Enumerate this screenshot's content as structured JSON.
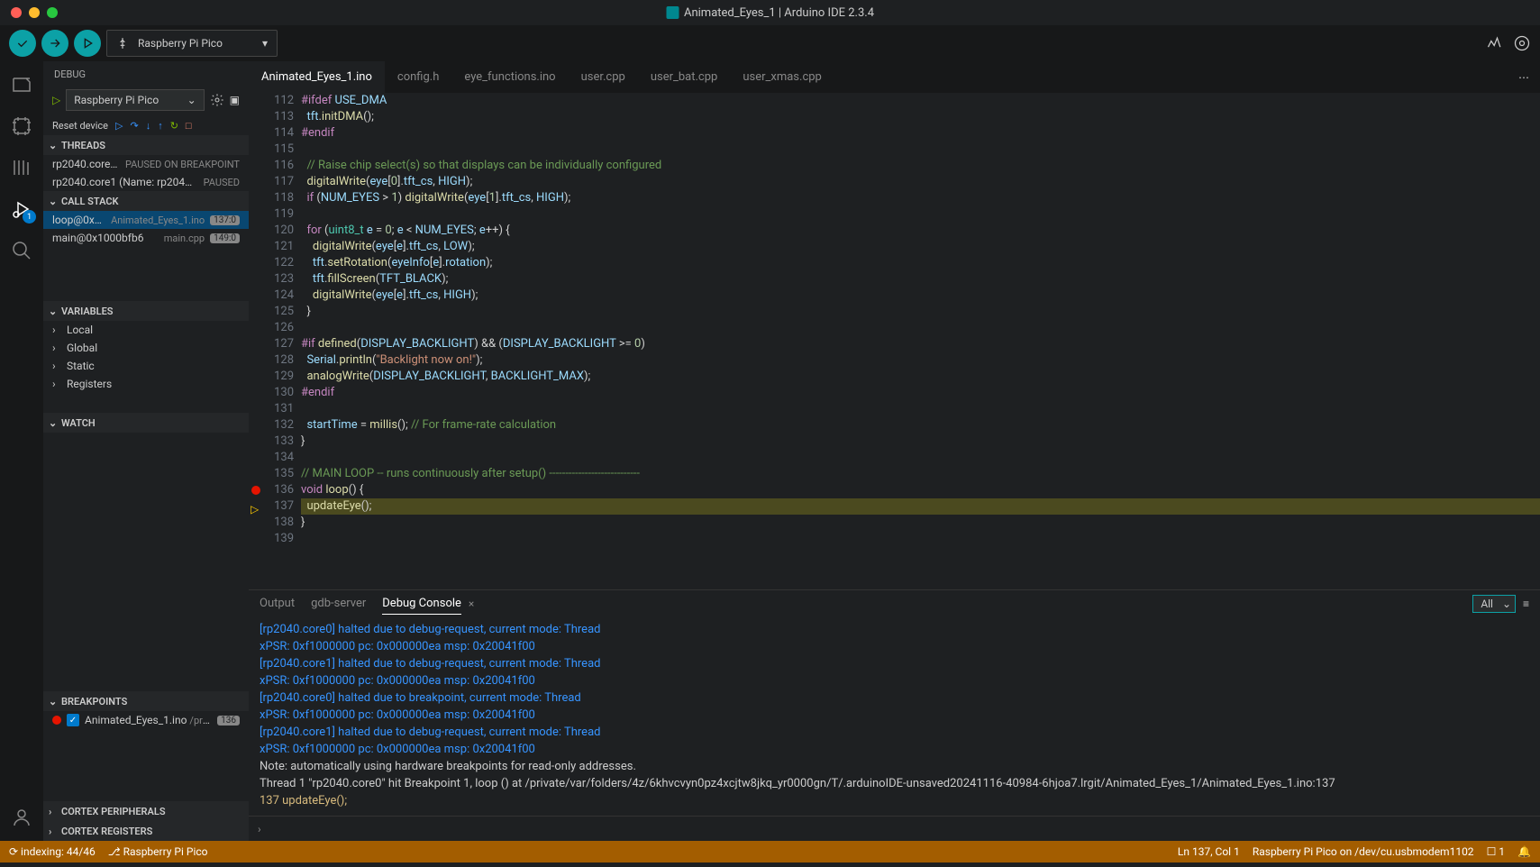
{
  "window": {
    "title": "Animated_Eyes_1 | Arduino IDE 2.3.4"
  },
  "toolbar": {
    "board": "Raspberry Pi Pico"
  },
  "debug": {
    "title": "DEBUG",
    "config": "Raspberry Pi Pico",
    "reset": "Reset device"
  },
  "sections": {
    "threads": "THREADS",
    "callstack": "CALL STACK",
    "variables": "VARIABLES",
    "watch": "WATCH",
    "breakpoints": "BREAKPOINTS",
    "cortex_periph": "CORTEX PERIPHERALS",
    "cortex_reg": "CORTEX REGISTERS"
  },
  "threads": [
    {
      "name": "rp2040.core0 (...",
      "state": "PAUSED ON BREAKPOINT"
    },
    {
      "name": "rp2040.core1 (Name: rp2040.core...",
      "state": "PAUSED"
    }
  ],
  "callstack": [
    {
      "fn": "loop@0x10003...",
      "file": "Animated_Eyes_1.ino",
      "line": "137:0"
    },
    {
      "fn": "main@0x1000bfb6",
      "file": "main.cpp",
      "line": "149:0"
    }
  ],
  "variables": [
    "Local",
    "Global",
    "Static",
    "Registers"
  ],
  "breakpoints": [
    {
      "file": "Animated_Eyes_1.ino",
      "path": "/private/var/...",
      "line": "136"
    }
  ],
  "tabs": [
    "Animated_Eyes_1.ino",
    "config.h",
    "eye_functions.ino",
    "user.cpp",
    "user_bat.cpp",
    "user_xmas.cpp"
  ],
  "panel": {
    "tabs": [
      "Output",
      "gdb-server",
      "Debug Console"
    ],
    "filter": "All",
    "lines": [
      {
        "cls": "cl-blue",
        "t": "[rp2040.core0] halted due to debug-request, current mode: Thread"
      },
      {
        "cls": "cl-blue",
        "t": "xPSR: 0xf1000000 pc: 0x000000ea msp: 0x20041f00"
      },
      {
        "cls": "cl-blue",
        "t": "[rp2040.core1] halted due to debug-request, current mode: Thread"
      },
      {
        "cls": "cl-blue",
        "t": "xPSR: 0xf1000000 pc: 0x000000ea msp: 0x20041f00"
      },
      {
        "cls": "cl-blue",
        "t": "[rp2040.core0] halted due to breakpoint, current mode: Thread"
      },
      {
        "cls": "cl-blue",
        "t": "xPSR: 0xf1000000 pc: 0x000000ea msp: 0x20041f00"
      },
      {
        "cls": "cl-blue",
        "t": "[rp2040.core1] halted due to debug-request, current mode: Thread"
      },
      {
        "cls": "cl-blue",
        "t": "xPSR: 0xf1000000 pc: 0x000000ea msp: 0x20041f00"
      },
      {
        "cls": "cl-gray",
        "t": "Note: automatically using hardware breakpoints for read-only addresses."
      },
      {
        "cls": "cl-gray",
        "t": "Thread 1 \"rp2040.core0\" hit Breakpoint 1, loop () at /private/var/folders/4z/6khvcvyn0pz4xcjtw8jkq_yr0000gn/T/.arduinoIDE-unsaved20241116-40984-6hjoa7.lrgit/Animated_Eyes_1/Animated_Eyes_1.ino:137"
      },
      {
        "cls": "cl-yellow",
        "t": "137        updateEye();"
      }
    ]
  },
  "status": {
    "indexing": "indexing: 44/46",
    "board": "Raspberry Pi Pico",
    "pos": "Ln 137, Col 1",
    "port": "Raspberry Pi Pico on /dev/cu.usbmodem1102",
    "notif": "1"
  },
  "code": {
    "start": 112,
    "lines": [
      "<span class='c-pp'>#ifdef</span> <span class='c-var'>USE_DMA</span>",
      "  <span class='c-var'>tft</span>.<span class='c-fn'>initDMA</span>();",
      "<span class='c-pp'>#endif</span>",
      "",
      "  <span class='c-cm'>// Raise chip select(s) so that displays can be individually configured</span>",
      "  <span class='c-fn'>digitalWrite</span>(<span class='c-var'>eye</span>[<span class='c-num'>0</span>].<span class='c-prop'>tft_cs</span>, <span class='c-var'>HIGH</span>);",
      "  <span class='c-kw'>if</span> (<span class='c-var'>NUM_EYES</span> &gt; <span class='c-num'>1</span>) <span class='c-fn'>digitalWrite</span>(<span class='c-var'>eye</span>[<span class='c-num'>1</span>].<span class='c-prop'>tft_cs</span>, <span class='c-var'>HIGH</span>);",
      "",
      "  <span class='c-kw'>for</span> (<span class='c-type'>uint8_t</span> <span class='c-var'>e</span> = <span class='c-num'>0</span>; <span class='c-var'>e</span> &lt; <span class='c-var'>NUM_EYES</span>; <span class='c-var'>e</span>++) {",
      "    <span class='c-fn'>digitalWrite</span>(<span class='c-var'>eye</span>[<span class='c-var'>e</span>].<span class='c-prop'>tft_cs</span>, <span class='c-var'>LOW</span>);",
      "    <span class='c-var'>tft</span>.<span class='c-fn'>setRotation</span>(<span class='c-var'>eyeInfo</span>[<span class='c-var'>e</span>].<span class='c-prop'>rotation</span>);",
      "    <span class='c-var'>tft</span>.<span class='c-fn'>fillScreen</span>(<span class='c-var'>TFT_BLACK</span>);",
      "    <span class='c-fn'>digitalWrite</span>(<span class='c-var'>eye</span>[<span class='c-var'>e</span>].<span class='c-prop'>tft_cs</span>, <span class='c-var'>HIGH</span>);",
      "  }",
      "",
      "<span class='c-pp'>#if</span> <span class='c-fn'>defined</span>(<span class='c-var'>DISPLAY_BACKLIGHT</span>) && (<span class='c-var'>DISPLAY_BACKLIGHT</span> &gt;= <span class='c-num'>0</span>)",
      "  <span class='c-var'>Serial</span>.<span class='c-fn'>println</span>(<span class='c-str'>\"Backlight now on!\"</span>);",
      "  <span class='c-fn'>analogWrite</span>(<span class='c-var'>DISPLAY_BACKLIGHT</span>, <span class='c-var'>BACKLIGHT_MAX</span>);",
      "<span class='c-pp'>#endif</span>",
      "",
      "  <span class='c-var'>startTime</span> = <span class='c-fn'>millis</span>(); <span class='c-cm'>// For frame-rate calculation</span>",
      "}",
      "",
      "<span class='c-cm'>// MAIN LOOP -- runs continuously after setup() ----------------------------</span>",
      "<span class='c-kw'>void</span> <span class='c-fn'>loop</span>() {",
      "  <span class='c-fn'>updateEye</span>();",
      "}",
      ""
    ],
    "breakpoint_line": 136,
    "current_line": 137
  }
}
